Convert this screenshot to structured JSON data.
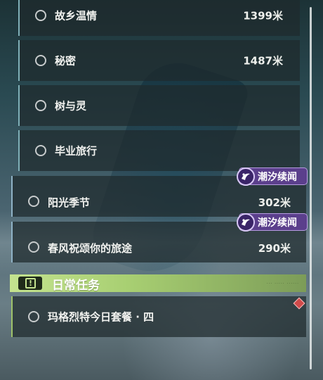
{
  "quests": [
    {
      "name": "故乡温情",
      "distance": "1399米"
    },
    {
      "name": "秘密",
      "distance": "1487米"
    },
    {
      "name": "树与灵",
      "distance": ""
    },
    {
      "name": "毕业旅行",
      "distance": ""
    }
  ],
  "event_quests": [
    {
      "name": "阳光季节",
      "distance": "302米",
      "tag": "潮汐续闻"
    },
    {
      "name": "春风祝颂你的旅途",
      "distance": "290米",
      "tag": "潮汐续闻"
    }
  ],
  "daily": {
    "title": "日常任务",
    "badge_symbol": "!",
    "items": [
      {
        "name": "玛格烈特今日套餐 · 四"
      }
    ]
  },
  "colors": {
    "daily_accent": "#a8cf72",
    "tag_purple": "#5b3f8c",
    "alert_red": "#d14a4a"
  }
}
